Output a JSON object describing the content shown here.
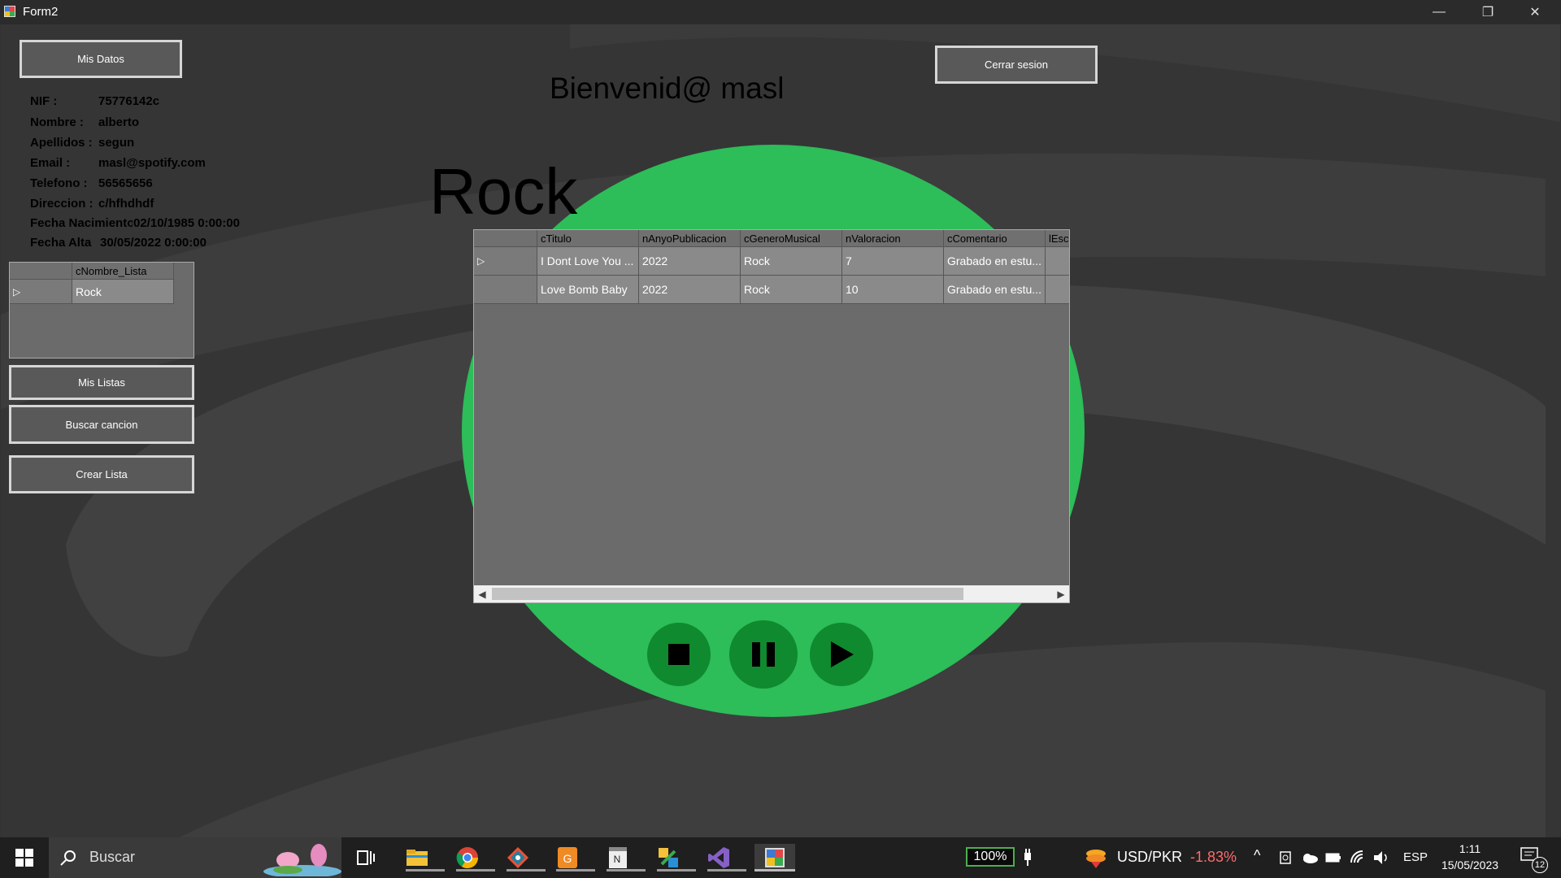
{
  "window": {
    "title": "Form2",
    "minimize": "—",
    "restore": "❐",
    "close": "✕"
  },
  "header": {
    "welcome": "Bienvenid@  masl",
    "logout_label": "Cerrar sesion",
    "my_data_label": "Mis Datos"
  },
  "genre_title": "Rock",
  "user_info": [
    {
      "label": "NIF :",
      "value": "75776142c"
    },
    {
      "label": "Nombre :",
      "value": "alberto"
    },
    {
      "label": "Apellidos :",
      "value": "segun"
    },
    {
      "label": "Email :",
      "value": "masl@spotify.com"
    },
    {
      "label": "Telefono :",
      "value": "56565656"
    },
    {
      "label": "Direccion :",
      "value": "c/hfhdhdf"
    },
    {
      "label": "Fecha Nacimiento",
      "value": "02/10/1985 0:00:00"
    },
    {
      "label": "Fecha Alta",
      "value": "30/05/2022 0:00:00"
    }
  ],
  "lists_grid": {
    "header": "cNombre_Lista",
    "rows": [
      "Rock"
    ]
  },
  "side_buttons": {
    "my_lists": "Mis Listas",
    "search_song": "Buscar cancion",
    "create_list": "Crear Lista"
  },
  "songs_grid": {
    "columns": [
      "cTitulo",
      "nAnyoPublicacion",
      "cGeneroMusical",
      "nValoracion",
      "cComentario",
      "lEsc"
    ],
    "rows": [
      [
        "I Dont Love You ...",
        "2022",
        "Rock",
        "7",
        "Grabado en estu..."
      ],
      [
        "Love Bomb Baby",
        "2022",
        "Rock",
        "10",
        "Grabado en estu..."
      ]
    ]
  },
  "player": {
    "stop": "stop-icon",
    "pause": "pause-icon",
    "play": "play-icon"
  },
  "colors": {
    "accent": "#2dbd59",
    "button_dark": "#0f8a2e",
    "background": "#353535"
  },
  "taskbar": {
    "search_placeholder": "Buscar",
    "battery": "100%",
    "currency": "USD/PKR",
    "currency_change": "-1.83%",
    "language": "ESP",
    "time": "1:11",
    "date": "15/05/2023",
    "notifications": "12"
  }
}
